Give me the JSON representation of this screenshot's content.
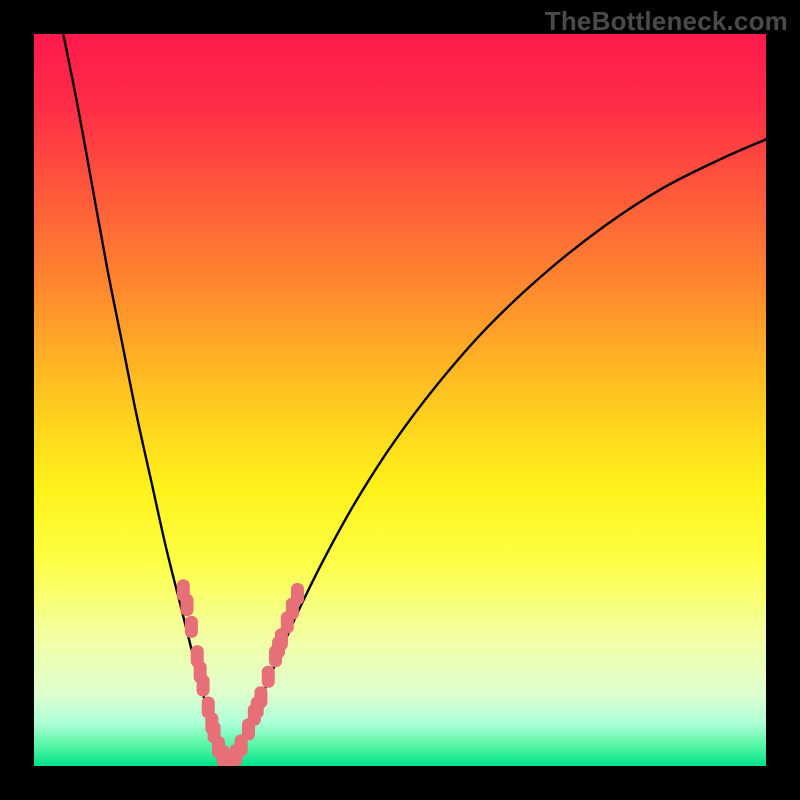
{
  "watermark": "TheBottleneck.com",
  "colors": {
    "frame": "#000000",
    "curve": "#000000",
    "marker": "#e76f77",
    "gradient_stops": [
      {
        "offset": 0.0,
        "color": "#ff1a4b"
      },
      {
        "offset": 0.1,
        "color": "#ff2d47"
      },
      {
        "offset": 0.22,
        "color": "#ff5a3a"
      },
      {
        "offset": 0.35,
        "color": "#ff8a2e"
      },
      {
        "offset": 0.5,
        "color": "#ffc81f"
      },
      {
        "offset": 0.62,
        "color": "#fff21a"
      },
      {
        "offset": 0.72,
        "color": "#fdff45"
      },
      {
        "offset": 0.82,
        "color": "#f4ffa0"
      },
      {
        "offset": 0.9,
        "color": "#e0ffd0"
      },
      {
        "offset": 0.94,
        "color": "#b0ffd8"
      },
      {
        "offset": 0.97,
        "color": "#5cf7a8"
      },
      {
        "offset": 1.0,
        "color": "#00e38a"
      }
    ]
  },
  "chart_data": {
    "type": "line",
    "title": "",
    "xlabel": "",
    "ylabel": "",
    "xlim": [
      0,
      100
    ],
    "ylim": [
      0,
      100
    ],
    "series": [
      {
        "name": "left-curve",
        "x": [
          4,
          6,
          8,
          10,
          12,
          14,
          16,
          18,
          20,
          21.5,
          22.8,
          23.8,
          24.5,
          25.2,
          25.8,
          26.2,
          26.6
        ],
        "y": [
          100,
          90,
          79,
          68,
          58,
          48,
          39,
          30,
          22,
          16,
          11,
          7,
          4.5,
          2.8,
          1.6,
          0.8,
          0.3
        ]
      },
      {
        "name": "right-curve",
        "x": [
          26.6,
          27.2,
          28,
          29,
          30.4,
          32,
          34,
          36.5,
          40,
          44,
          49,
          55,
          62,
          70,
          78,
          86,
          94,
          100
        ],
        "y": [
          0.3,
          1.0,
          2.4,
          4.6,
          7.8,
          11.6,
          16.4,
          22,
          29,
          36.2,
          44,
          52,
          60,
          67.5,
          73.8,
          79,
          83,
          85.6
        ]
      }
    ],
    "markers": {
      "name": "highlighted-points",
      "points": [
        {
          "x": 20.4,
          "y": 24.0
        },
        {
          "x": 20.9,
          "y": 22.0
        },
        {
          "x": 21.5,
          "y": 19.0
        },
        {
          "x": 22.3,
          "y": 15.0
        },
        {
          "x": 22.7,
          "y": 12.8
        },
        {
          "x": 23.1,
          "y": 11.0
        },
        {
          "x": 23.8,
          "y": 8.0
        },
        {
          "x": 24.3,
          "y": 5.8
        },
        {
          "x": 24.6,
          "y": 4.6
        },
        {
          "x": 25.2,
          "y": 2.6
        },
        {
          "x": 25.8,
          "y": 1.4
        },
        {
          "x": 26.4,
          "y": 0.6
        },
        {
          "x": 27.0,
          "y": 0.7
        },
        {
          "x": 27.6,
          "y": 1.5
        },
        {
          "x": 28.3,
          "y": 2.8
        },
        {
          "x": 29.3,
          "y": 5.0
        },
        {
          "x": 30.1,
          "y": 7.0
        },
        {
          "x": 30.5,
          "y": 8.0
        },
        {
          "x": 31.0,
          "y": 9.4
        },
        {
          "x": 32.0,
          "y": 12.2
        },
        {
          "x": 33.0,
          "y": 15.0
        },
        {
          "x": 33.4,
          "y": 16.2
        },
        {
          "x": 33.8,
          "y": 17.3
        },
        {
          "x": 34.6,
          "y": 19.6
        },
        {
          "x": 35.3,
          "y": 21.5
        },
        {
          "x": 36.0,
          "y": 23.5
        }
      ]
    }
  }
}
